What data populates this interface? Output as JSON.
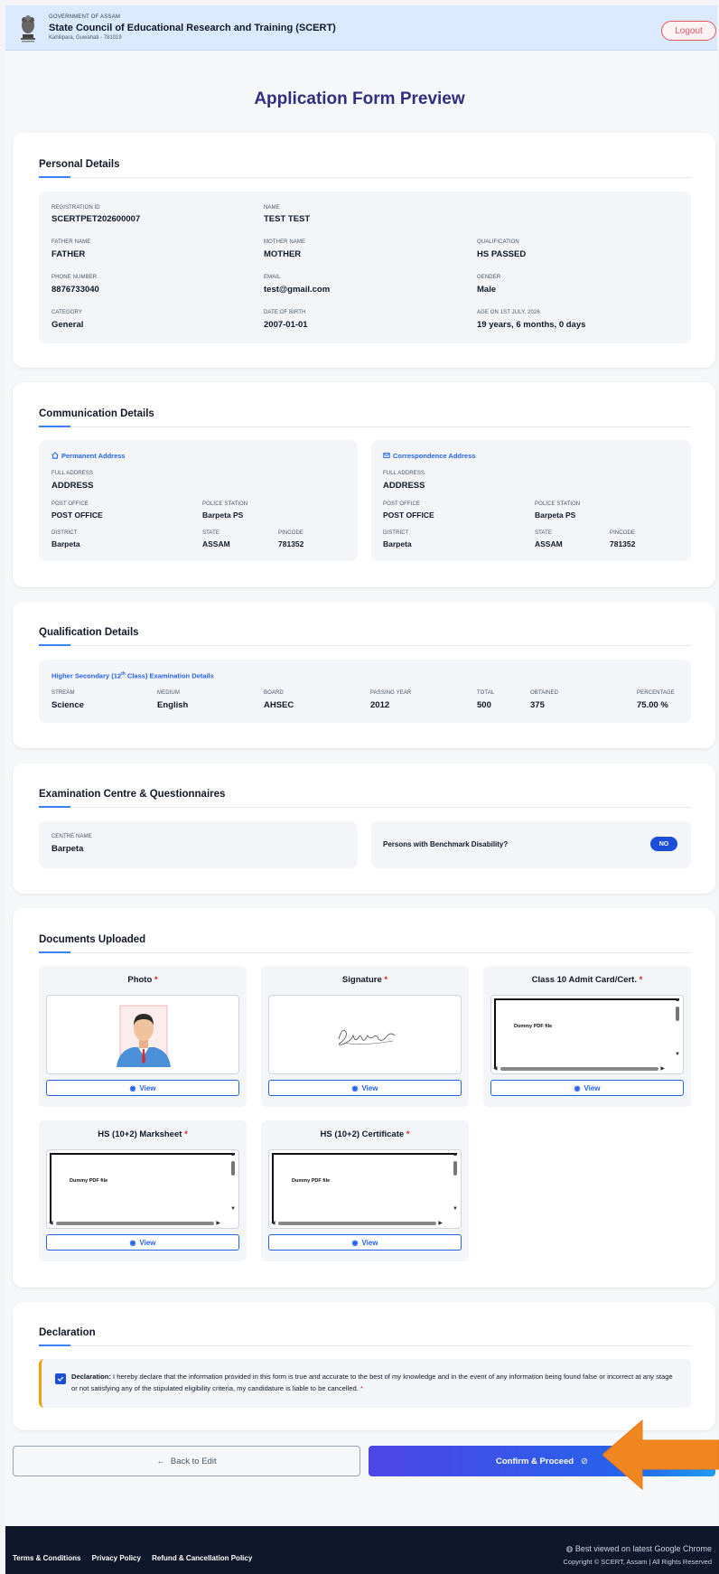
{
  "header": {
    "gov": "GOVERNMENT OF ASSAM",
    "org": "State Council of Educational Research and Training (SCERT)",
    "address": "Kahilipara, Guwahati - 781019",
    "logout": "Logout"
  },
  "page_title": "Application Form Preview",
  "personal": {
    "title": "Personal Details",
    "fields": [
      {
        "label": "REGISTRATION ID",
        "value": "SCERTPET202600007"
      },
      {
        "label": "NAME",
        "value": "TEST TEST"
      },
      {
        "label": "FATHER NAME",
        "value": "FATHER"
      },
      {
        "label": "MOTHER NAME",
        "value": "MOTHER"
      },
      {
        "label": "QUALIFICATION",
        "value": "HS PASSED"
      },
      {
        "label": "PHONE NUMBER",
        "value": "8876733040"
      },
      {
        "label": "EMAIL",
        "value": "test@gmail.com"
      },
      {
        "label": "GENDER",
        "value": "Male"
      },
      {
        "label": "CATEGORY",
        "value": "General"
      },
      {
        "label": "DATE OF BIRTH",
        "value": "2007-01-01"
      },
      {
        "label": "AGE ON 1ST JULY, 2026",
        "value": "19 years, 6 months, 0 days"
      }
    ]
  },
  "communication": {
    "title": "Communication Details",
    "permanent": {
      "heading": "Permanent Address",
      "full_label": "FULL ADDRESS",
      "full": "ADDRESS",
      "po_label": "POST OFFICE",
      "po": "POST OFFICE",
      "ps_label": "POLICE STATION",
      "ps": "Barpeta PS",
      "district_label": "DISTRICT",
      "district": "Barpeta",
      "state_label": "STATE",
      "state": "ASSAM",
      "pin_label": "PINCODE",
      "pin": "781352"
    },
    "correspondence": {
      "heading": "Correspondence Address",
      "full_label": "FULL ADDRESS",
      "full": "ADDRESS",
      "po_label": "POST OFFICE",
      "po": "POST OFFICE",
      "ps_label": "POLICE STATION",
      "ps": "Barpeta PS",
      "district_label": "DISTRICT",
      "district": "Barpeta",
      "state_label": "STATE",
      "state": "ASSAM",
      "pin_label": "PINCODE",
      "pin": "781352"
    }
  },
  "qualification": {
    "title": "Qualification Details",
    "heading_pre": "Higher Secondary (12",
    "heading_sup": "th",
    "heading_post": " Class) Examination Details",
    "fields": [
      {
        "label": "STREAM",
        "value": "Science"
      },
      {
        "label": "MEDIUM",
        "value": "English"
      },
      {
        "label": "BOARD",
        "value": "AHSEC"
      },
      {
        "label": "PASSING YEAR",
        "value": "2012"
      },
      {
        "label": "TOTAL",
        "value": "500"
      },
      {
        "label": "OBTAINED",
        "value": "375"
      },
      {
        "label": "PERCENTAGE",
        "value": "75.00 %"
      }
    ]
  },
  "exam": {
    "title": "Examination Centre & Questionnaires",
    "centre_label": "CENTRE NAME",
    "centre": "Barpeta",
    "disability_q": "Persons with Benchmark Disability?",
    "disability_a": "NO"
  },
  "documents": {
    "title": "Documents Uploaded",
    "required_mark": "*",
    "view_label": "View",
    "pdf_text": "Dummy PDF file",
    "signature_text": "Signature",
    "items": [
      {
        "name": "Photo"
      },
      {
        "name": "Signature"
      },
      {
        "name": "Class 10 Admit Card/Cert."
      },
      {
        "name": "HS (10+2) Marksheet"
      },
      {
        "name": "HS (10+2) Certificate"
      }
    ]
  },
  "declaration": {
    "title": "Declaration",
    "lead": "Declaration:",
    "text": " I hereby declare that the information provided in this form is true and accurate to the best of my knowledge and in the event of any information being found false or incorrect at any stage or not satisfying any of the stipulated eligibility criteria, my candidature is liable to be cancelled. ",
    "required_mark": "*"
  },
  "actions": {
    "back": "Back to Edit",
    "confirm": "Confirm & Proceed"
  },
  "footer": {
    "links": [
      "Terms & Conditions",
      "Privacy Policy",
      "Refund & Cancellation Policy"
    ],
    "best_viewed": "Best viewed on latest Google Chrome",
    "copyright": "Copyright © SCERT, Assam | All Rights Reserved"
  },
  "colors": {
    "accent": "#2563eb",
    "title": "#312e81",
    "danger": "#e25563",
    "highlight_arrow": "#f0861f"
  }
}
